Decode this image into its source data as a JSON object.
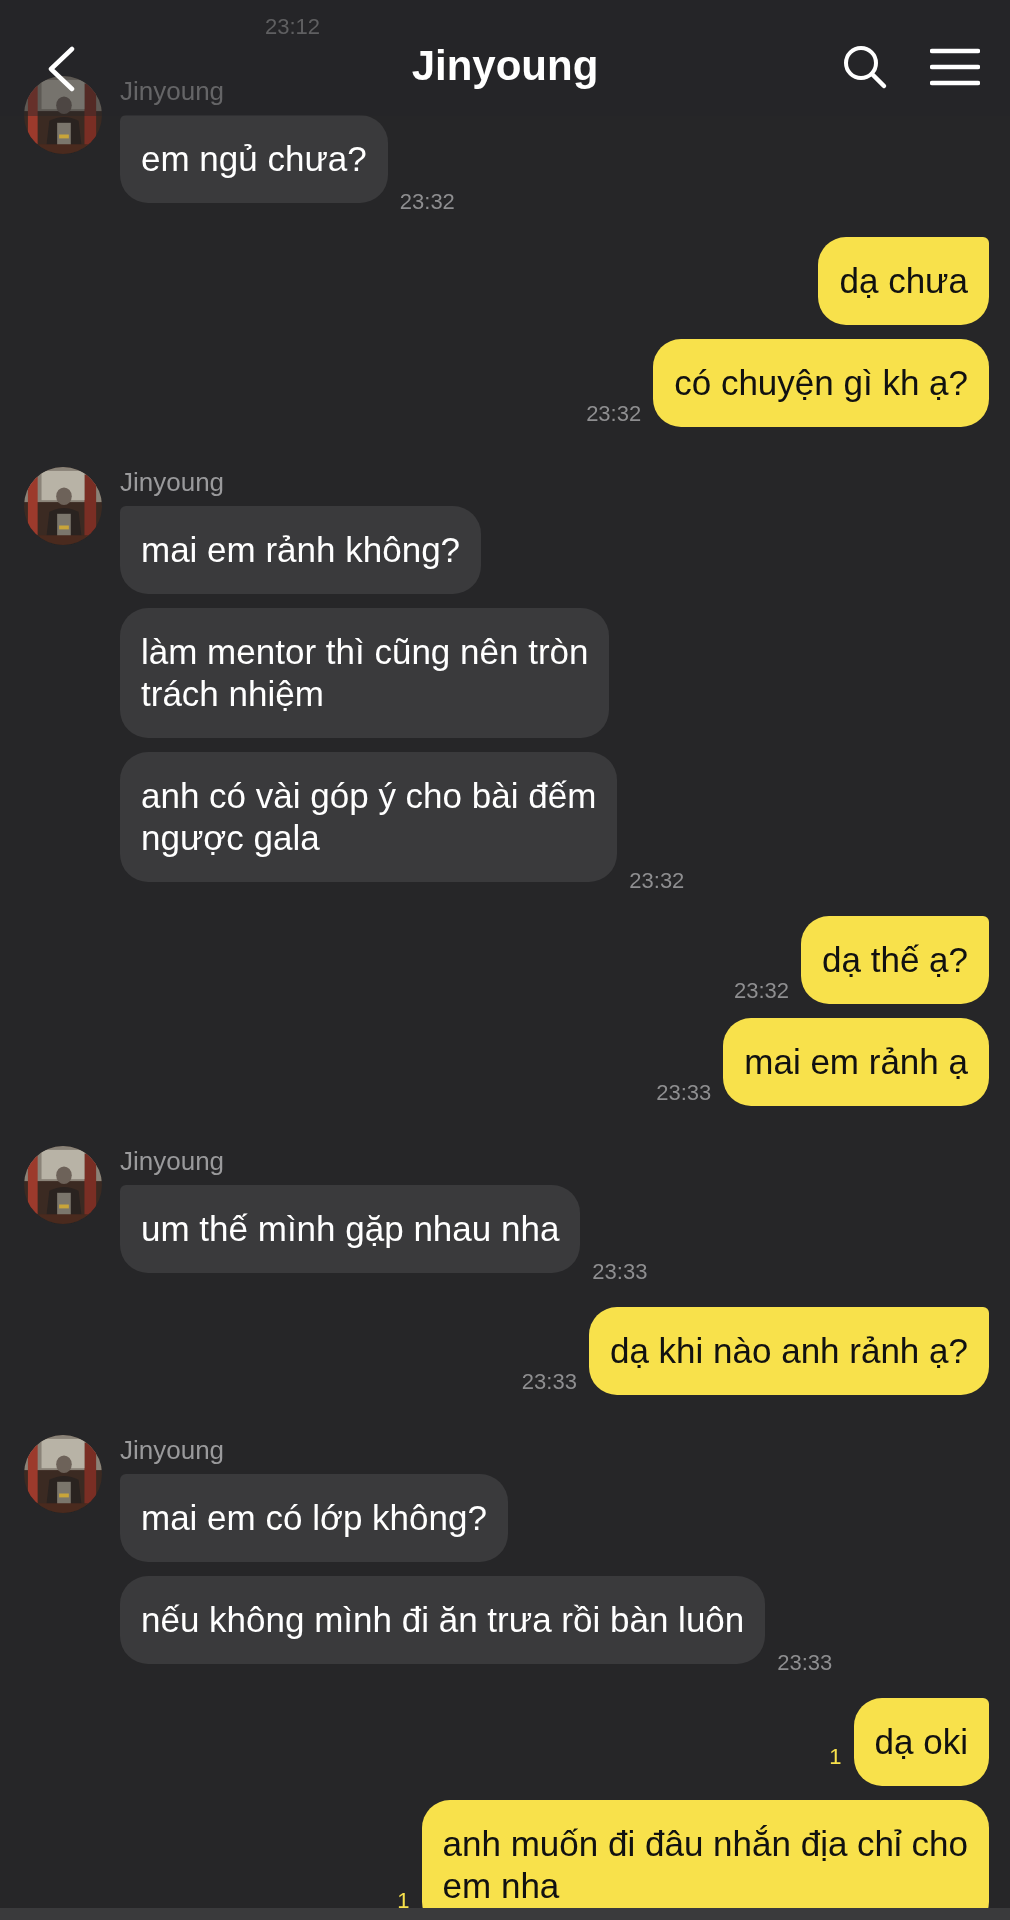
{
  "header": {
    "title": "Jinyoung"
  },
  "top_time": "23:12",
  "groups": [
    {
      "kind": "them",
      "name": "Jinyoung",
      "messages": [
        {
          "text": "em ngủ chưa?",
          "time": "23:32"
        }
      ]
    },
    {
      "kind": "me",
      "messages": [
        {
          "text": "dạ chưa"
        },
        {
          "text": "có chuyện gì kh ạ?",
          "time": "23:32"
        }
      ]
    },
    {
      "kind": "them",
      "name": "Jinyoung",
      "messages": [
        {
          "text": "mai em rảnh không?"
        },
        {
          "text": "làm mentor thì cũng nên tròn\ntrách nhiệm"
        },
        {
          "text": "anh có vài góp ý cho bài đếm\nngược gala",
          "time": "23:32"
        }
      ]
    },
    {
      "kind": "me",
      "messages": [
        {
          "text": "dạ thế ạ?",
          "time": "23:32"
        },
        {
          "text": "mai em rảnh ạ",
          "time": "23:33"
        }
      ]
    },
    {
      "kind": "them",
      "name": "Jinyoung",
      "messages": [
        {
          "text": "um thế mình gặp nhau nha",
          "time": "23:33"
        }
      ]
    },
    {
      "kind": "me",
      "messages": [
        {
          "text": "dạ khi nào anh rảnh ạ?",
          "time": "23:33"
        }
      ]
    },
    {
      "kind": "them",
      "name": "Jinyoung",
      "messages": [
        {
          "text": "mai em có lớp không?"
        },
        {
          "text": "nếu không mình đi ăn trưa rồi bàn luôn",
          "time": "23:33"
        }
      ]
    },
    {
      "kind": "me",
      "messages": [
        {
          "text": "dạ oki",
          "unread": "1"
        },
        {
          "text": "anh muốn đi đâu nhắn địa chỉ cho\nem nha",
          "unread": "1"
        }
      ]
    }
  ]
}
